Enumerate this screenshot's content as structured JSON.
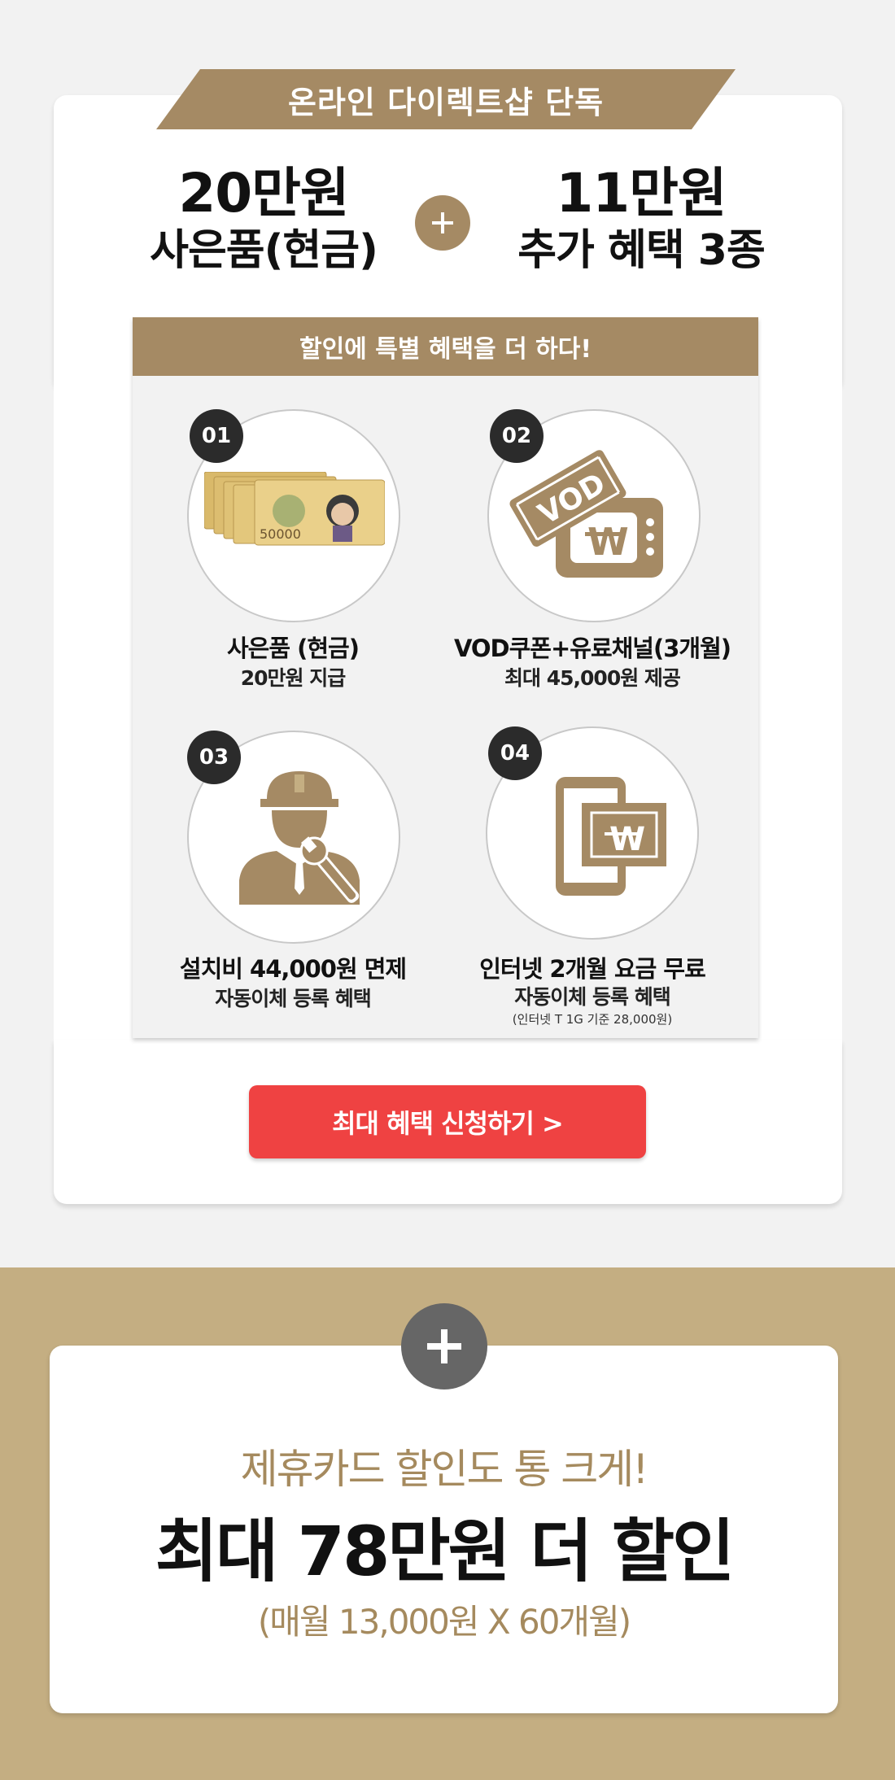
{
  "ribbon": {
    "label": "온라인 다이렉트샵 단독"
  },
  "headline": {
    "left_big": "20만원",
    "left_sub": "사은품(현금)",
    "right_big": "11만원",
    "right_sub": "추가 혜택 3종"
  },
  "benefits": {
    "header": "할인에 특별 혜택을 더 하다!",
    "items": [
      {
        "num": "01",
        "icon": "cash-bills-icon",
        "title": "사은품 (현금)",
        "sub": "20만원 지급",
        "note": "",
        "bill_text": "50000"
      },
      {
        "num": "02",
        "icon": "vod-tv-icon",
        "title": "VOD쿠폰+유료채널(3개월)",
        "sub": "최대 45,000원 제공",
        "note": "",
        "coupon_text": "VOD"
      },
      {
        "num": "03",
        "icon": "technician-icon",
        "title": "설치비 44,000원 면제",
        "sub": "자동이체 등록 혜택",
        "note": ""
      },
      {
        "num": "04",
        "icon": "phone-payment-icon",
        "title": "인터넷 2개월 요금 무료",
        "sub": "자동이체 등록 혜택",
        "note": "(인터넷 T 1G 기준 28,000원)"
      }
    ]
  },
  "cta": {
    "label": "최대 혜택 신청하기 >"
  },
  "card_promo": {
    "line1": "제휴카드 할인도 통 크게!",
    "line2": "최대 78만원 더 할인",
    "line3": "(매월 13,000원 X 60개월)"
  },
  "colors": {
    "gold": "#a58a64",
    "band": "#c4ae82",
    "cta": "#ef4242",
    "dark": "#2b2b2b"
  }
}
